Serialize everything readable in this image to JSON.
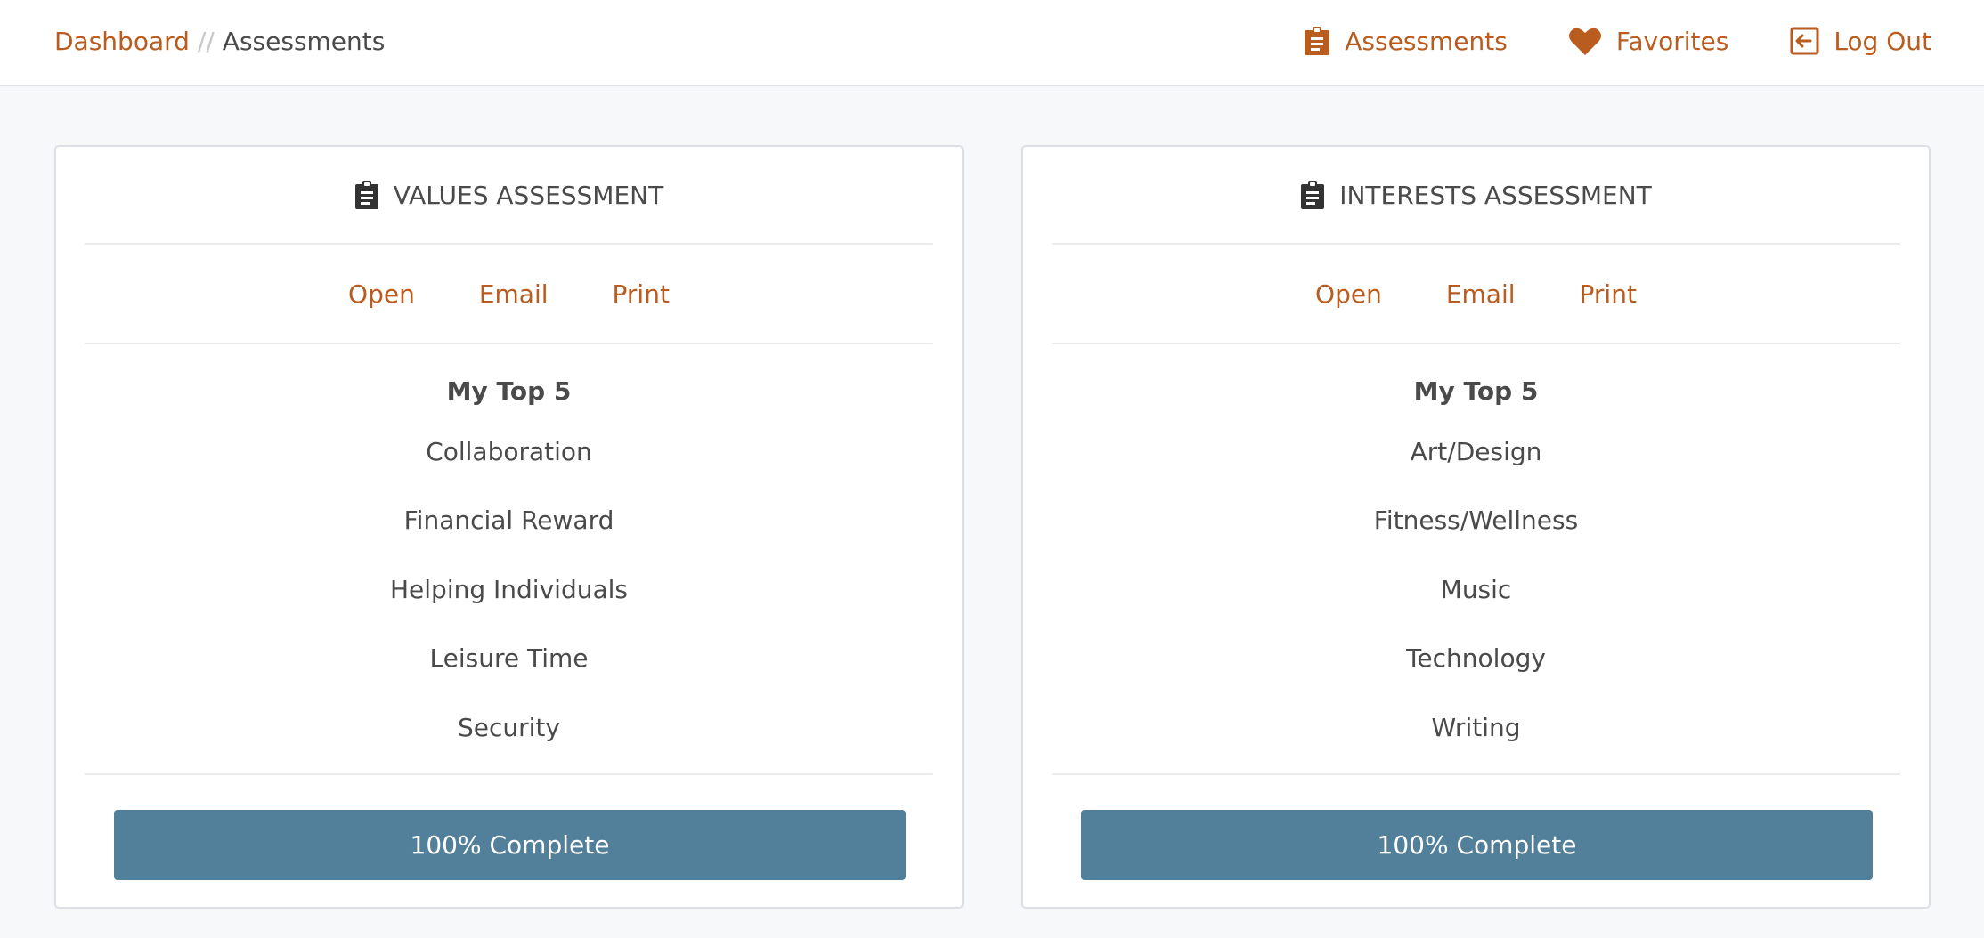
{
  "breadcrumb": {
    "home": "Dashboard",
    "separator": "//",
    "current": "Assessments"
  },
  "nav": {
    "assessments": {
      "label": "Assessments",
      "icon": "clipboard-icon"
    },
    "favorites": {
      "label": "Favorites",
      "icon": "heart-icon"
    },
    "logout": {
      "label": "Log Out",
      "icon": "log-out-icon"
    }
  },
  "cards": [
    {
      "title": "VALUES ASSESSMENT",
      "actions": {
        "open": "Open",
        "email": "Email",
        "print": "Print"
      },
      "top5_heading": "My Top 5",
      "items": [
        "Collaboration",
        "Financial Reward",
        "Helping Individuals",
        "Leisure Time",
        "Security"
      ],
      "progress_label": "100% Complete",
      "progress_value": 100
    },
    {
      "title": "INTERESTS ASSESSMENT",
      "actions": {
        "open": "Open",
        "email": "Email",
        "print": "Print"
      },
      "top5_heading": "My Top 5",
      "items": [
        "Art/Design",
        "Fitness/Wellness",
        "Music",
        "Technology",
        "Writing"
      ],
      "progress_label": "100% Complete",
      "progress_value": 100
    }
  ],
  "colors": {
    "accent": "#b85c1f",
    "progress": "#52809b",
    "background": "#f7f8fa"
  }
}
